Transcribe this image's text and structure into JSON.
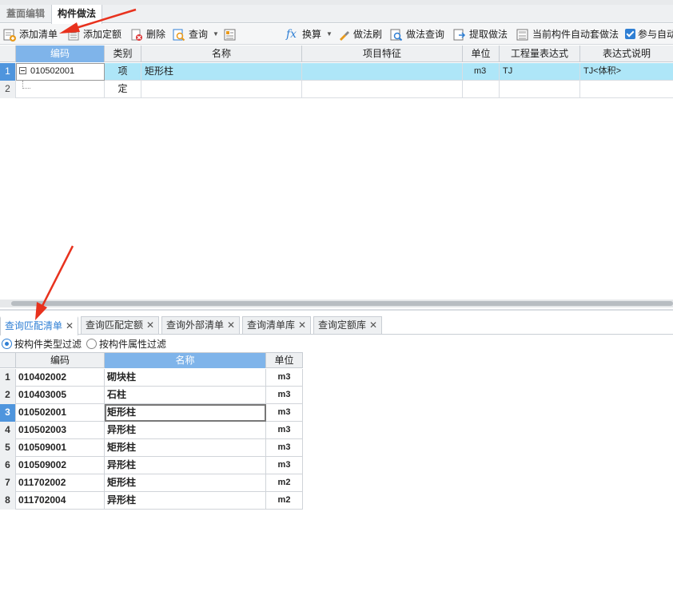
{
  "tabs": [
    {
      "label": "蓋面编辑",
      "active": false
    },
    {
      "label": "构件做法",
      "active": true
    }
  ],
  "toolbar": {
    "add_list": "添加清单",
    "add_quota": "添加定额",
    "delete": "删除",
    "query": "查询",
    "convert": "换算",
    "method_brush": "做法刷",
    "method_query": "做法查询",
    "extract_method": "提取做法",
    "auto_apply": "当前构件自动套做法",
    "participate": "参与自动"
  },
  "top_grid": {
    "headers": [
      "编码",
      "类别",
      "名称",
      "项目特征",
      "单位",
      "工程量表达式",
      "表达式说明"
    ],
    "rows": [
      {
        "num": "1",
        "code": "010502001",
        "type": "项",
        "name": "矩形柱",
        "feature": "",
        "unit": "m3",
        "expr": "TJ",
        "desc": "TJ<体积>"
      },
      {
        "num": "2",
        "code": "",
        "type": "定",
        "name": "",
        "feature": "",
        "unit": "",
        "expr": "",
        "desc": ""
      }
    ]
  },
  "bottom_tabs": [
    {
      "label": "查询匹配清单",
      "active": true
    },
    {
      "label": "查询匹配定额",
      "active": false
    },
    {
      "label": "查询外部清单",
      "active": false
    },
    {
      "label": "查询清单库",
      "active": false
    },
    {
      "label": "查询定额库",
      "active": false
    }
  ],
  "filters": {
    "by_type": "按构件类型过滤",
    "by_attr": "按构件属性过滤"
  },
  "bottom_grid": {
    "headers": [
      "编码",
      "名称",
      "单位"
    ],
    "rows": [
      {
        "num": "1",
        "code": "010402002",
        "name": "砌块柱",
        "unit": "m3"
      },
      {
        "num": "2",
        "code": "010403005",
        "name": "石柱",
        "unit": "m3"
      },
      {
        "num": "3",
        "code": "010502001",
        "name": "矩形柱",
        "unit": "m3"
      },
      {
        "num": "4",
        "code": "010502003",
        "name": "异形柱",
        "unit": "m3"
      },
      {
        "num": "5",
        "code": "010509001",
        "name": "矩形柱",
        "unit": "m3"
      },
      {
        "num": "6",
        "code": "010509002",
        "name": "异形柱",
        "unit": "m3"
      },
      {
        "num": "7",
        "code": "011702002",
        "name": "矩形柱",
        "unit": "m2"
      },
      {
        "num": "8",
        "code": "011702004",
        "name": "异形柱",
        "unit": "m2"
      }
    ]
  },
  "colors": {
    "accent": "#2f7fd4",
    "selected_row": "#aee6f8",
    "header_highlight": "#7fb4ea",
    "annotation_arrow": "#e8321e"
  }
}
